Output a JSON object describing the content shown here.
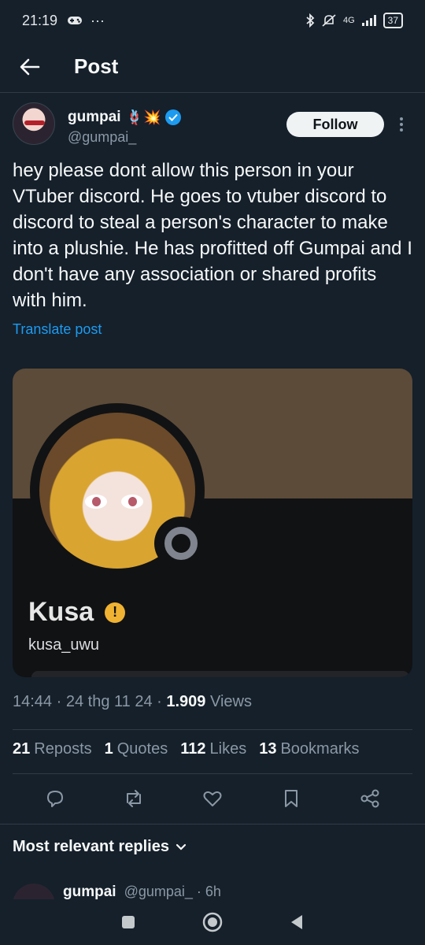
{
  "status_bar": {
    "time": "21:19",
    "network": "4G",
    "battery": "37"
  },
  "top_bar": {
    "title": "Post"
  },
  "author": {
    "name": "gumpai",
    "badges": "🪢💥",
    "handle": "@gumpai_",
    "follow_label": "Follow"
  },
  "post": {
    "text": "hey please dont allow this person in your VTuber discord. He goes to vtuber discord to discord to steal a person's character to make into a plushie. He has profitted off Gumpai and I don't have any association or shared profits with him.",
    "translate_label": "Translate post"
  },
  "embedded_profile": {
    "display_name": "Kusa",
    "username": "kusa_uwu",
    "warning_glyph": "!",
    "banner_color": "#5c4b38"
  },
  "meta": {
    "time": "14:44",
    "date": "24 thg 11 24",
    "views_count": "1.909",
    "views_label": "Views"
  },
  "stats": {
    "reposts_count": "21",
    "reposts_label": "Reposts",
    "quotes_count": "1",
    "quotes_label": "Quotes",
    "likes_count": "112",
    "likes_label": "Likes",
    "bookmarks_count": "13",
    "bookmarks_label": "Bookmarks"
  },
  "replies": {
    "sort_label": "Most relevant replies",
    "peek_name": "gumpai",
    "peek_handle": "@gumpai_ · 6h"
  },
  "colors": {
    "background": "#15202b",
    "accent": "#1d9bf0",
    "muted": "#8b98a5"
  }
}
